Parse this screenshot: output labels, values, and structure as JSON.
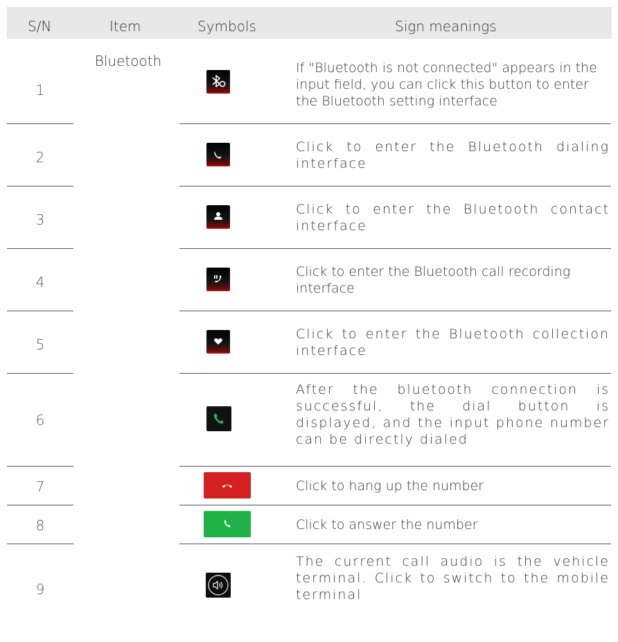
{
  "header": {
    "sn": "S/N",
    "item": "Item",
    "symbols": "Symbols",
    "meanings": "Sign meanings"
  },
  "item_group": "Bluetooth",
  "rows": [
    {
      "sn": "1",
      "icon": "bluetooth-disconnected-icon",
      "text": "If \"Bluetooth is not connected\" appears in the input field, you can click this button to enter the Bluetooth setting interface"
    },
    {
      "sn": "2",
      "icon": "phone-dial-icon",
      "text": "Click to enter the Bluetooth dialing interface"
    },
    {
      "sn": "3",
      "icon": "contact-person-icon",
      "text": "Click to enter the Bluetooth contact interface"
    },
    {
      "sn": "4",
      "icon": "call-recording-icon",
      "text": "Click to enter the Bluetooth call recording interface"
    },
    {
      "sn": "5",
      "icon": "heart-collection-icon",
      "text": "Click to enter the Bluetooth collection interface"
    },
    {
      "sn": "6",
      "icon": "green-dial-icon",
      "text": "After the bluetooth connection is successful, the dial button is displayed, and the input phone number can be directly dialed"
    },
    {
      "sn": "7",
      "icon": "hang-up-button-icon",
      "text": "Click to hang up the number",
      "color": "#d42020"
    },
    {
      "sn": "8",
      "icon": "answer-button-icon",
      "text": "Click to answer the number",
      "color": "#1fb347"
    },
    {
      "sn": "9",
      "icon": "speaker-audio-switch-icon",
      "text": "The current call audio is the vehicle terminal. Click to switch to the mobile terminal"
    }
  ]
}
